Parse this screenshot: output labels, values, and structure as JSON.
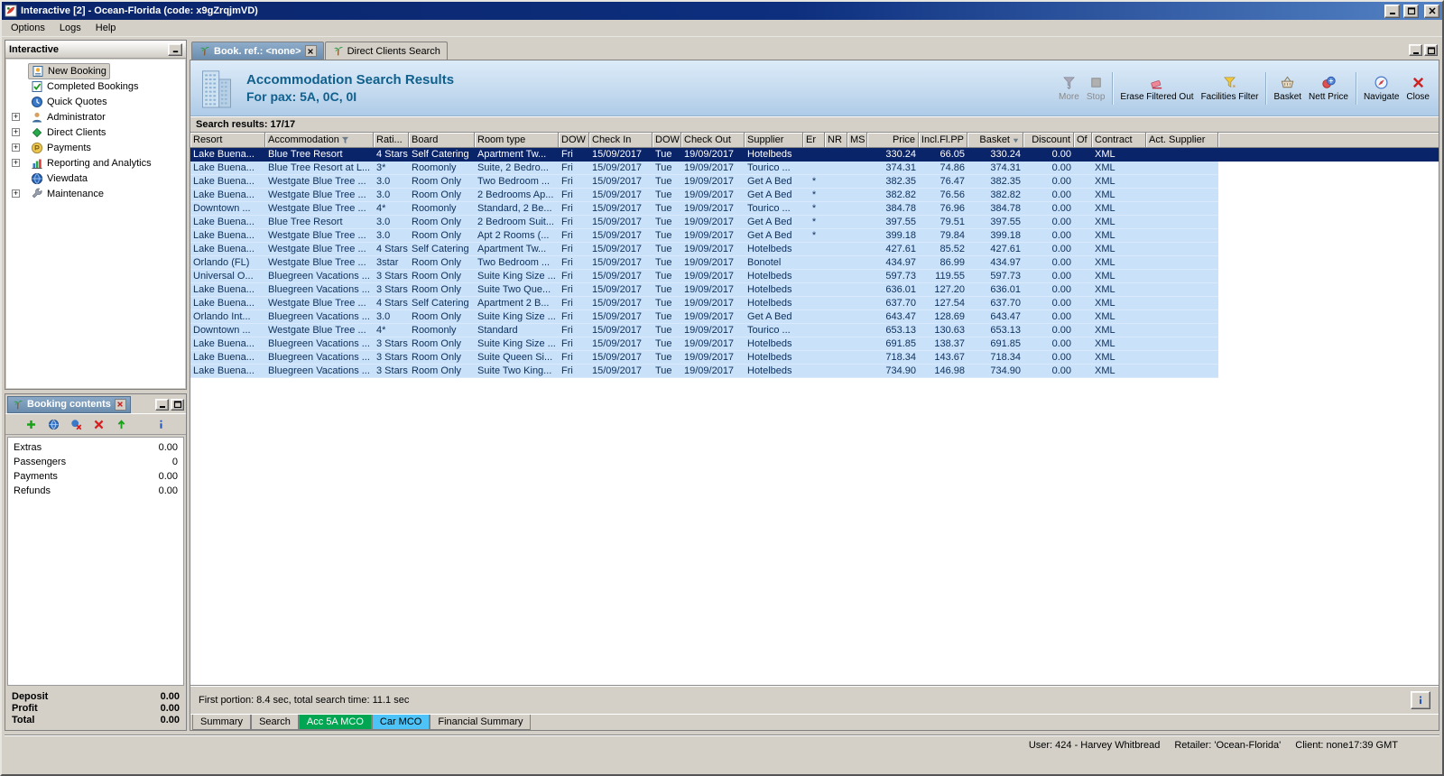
{
  "window": {
    "title": "Interactive [2] - Ocean-Florida (code: x9gZrqjmVD)",
    "menu": [
      "Options",
      "Logs",
      "Help"
    ]
  },
  "sidebar": {
    "title": "Interactive",
    "items": [
      {
        "label": "New Booking",
        "icon": "booking",
        "selected": true
      },
      {
        "label": "Completed Bookings",
        "icon": "completed"
      },
      {
        "label": "Quick Quotes",
        "icon": "quotes"
      },
      {
        "label": "Administrator",
        "icon": "admin",
        "expandable": true
      },
      {
        "label": "Direct Clients",
        "icon": "clients",
        "expandable": true
      },
      {
        "label": "Payments",
        "icon": "payments",
        "expandable": true
      },
      {
        "label": "Reporting and Analytics",
        "icon": "reporting",
        "expandable": true
      },
      {
        "label": "Viewdata",
        "icon": "viewdata"
      },
      {
        "label": "Maintenance",
        "icon": "maintenance",
        "expandable": true
      }
    ]
  },
  "booking_contents": {
    "title": "Booking contents",
    "toolbar_icons": [
      "add",
      "globe",
      "cancel",
      "delete",
      "export",
      "info"
    ],
    "rows": [
      {
        "label": "Extras",
        "value": "0.00"
      },
      {
        "label": "Passengers",
        "value": "0"
      },
      {
        "label": "Payments",
        "value": "0.00"
      },
      {
        "label": "Refunds",
        "value": "0.00"
      }
    ],
    "totals": [
      {
        "label": "Deposit",
        "value": "0.00"
      },
      {
        "label": "Profit",
        "value": "0.00"
      },
      {
        "label": "Total",
        "value": "0.00"
      }
    ]
  },
  "document_tabs": [
    {
      "label": "Book. ref.: <none>",
      "active": true,
      "closable": true
    },
    {
      "label": "Direct Clients Search",
      "active": false
    }
  ],
  "header": {
    "title": "Accommodation Search Results",
    "subtitle": "For pax: 5A, 0C, 0I",
    "toolbar": [
      {
        "label": "More",
        "icon": "more",
        "disabled": true
      },
      {
        "label": "Stop",
        "icon": "stop",
        "disabled": true
      },
      {
        "separator": true
      },
      {
        "label": "Erase Filtered Out",
        "icon": "eraser"
      },
      {
        "label": "Facilities Filter",
        "icon": "funnel"
      },
      {
        "separator": true
      },
      {
        "label": "Basket",
        "icon": "basket"
      },
      {
        "label": "Nett Price",
        "icon": "coins"
      },
      {
        "separator": true
      },
      {
        "label": "Navigate",
        "icon": "navigate"
      },
      {
        "label": "Close",
        "icon": "close"
      }
    ]
  },
  "results": {
    "label": "Search results: 17/17",
    "selected_index": 0,
    "columns": [
      {
        "label": "Resort"
      },
      {
        "label": "Accommodation",
        "filter": true
      },
      {
        "label": "Rati..."
      },
      {
        "label": "Board"
      },
      {
        "label": "Room type"
      },
      {
        "label": "DOW"
      },
      {
        "label": "Check In"
      },
      {
        "label": "DOW"
      },
      {
        "label": "Check Out"
      },
      {
        "label": "Supplier"
      },
      {
        "label": "Er"
      },
      {
        "label": "NR"
      },
      {
        "label": "MS"
      },
      {
        "label": "Price"
      },
      {
        "label": "Incl.Fl.PP"
      },
      {
        "label": "Basket",
        "sort": true
      },
      {
        "label": "Discount"
      },
      {
        "label": "Of"
      },
      {
        "label": "Contract"
      },
      {
        "label": "Act. Supplier"
      }
    ],
    "rows": [
      [
        "Lake Buena...",
        "Blue Tree Resort",
        "4 Stars",
        "Self Catering",
        "Apartment Tw...",
        "Fri",
        "15/09/2017",
        "Tue",
        "19/09/2017",
        "Hotelbeds",
        "",
        "",
        "",
        "330.24",
        "66.05",
        "330.24",
        "0.00",
        "",
        "XML",
        ""
      ],
      [
        "Lake Buena...",
        "Blue Tree Resort at L...",
        "3*",
        "Roomonly",
        "Suite, 2 Bedro...",
        "Fri",
        "15/09/2017",
        "Tue",
        "19/09/2017",
        "Tourico ...",
        "",
        "",
        "",
        "374.31",
        "74.86",
        "374.31",
        "0.00",
        "",
        "XML",
        ""
      ],
      [
        "Lake Buena...",
        "Westgate Blue Tree ...",
        "3.0",
        "Room Only",
        "Two Bedroom ...",
        "Fri",
        "15/09/2017",
        "Tue",
        "19/09/2017",
        "Get A Bed",
        "*",
        "",
        "",
        "382.35",
        "76.47",
        "382.35",
        "0.00",
        "",
        "XML",
        ""
      ],
      [
        "Lake Buena...",
        "Westgate Blue Tree ...",
        "3.0",
        "Room Only",
        "2 Bedrooms Ap...",
        "Fri",
        "15/09/2017",
        "Tue",
        "19/09/2017",
        "Get A Bed",
        "*",
        "",
        "",
        "382.82",
        "76.56",
        "382.82",
        "0.00",
        "",
        "XML",
        ""
      ],
      [
        "Downtown ...",
        "Westgate Blue Tree ...",
        "4*",
        "Roomonly",
        "Standard, 2 Be...",
        "Fri",
        "15/09/2017",
        "Tue",
        "19/09/2017",
        "Tourico ...",
        "*",
        "",
        "",
        "384.78",
        "76.96",
        "384.78",
        "0.00",
        "",
        "XML",
        ""
      ],
      [
        "Lake Buena...",
        "Blue Tree Resort",
        "3.0",
        "Room Only",
        "2 Bedroom Suit...",
        "Fri",
        "15/09/2017",
        "Tue",
        "19/09/2017",
        "Get A Bed",
        "*",
        "",
        "",
        "397.55",
        "79.51",
        "397.55",
        "0.00",
        "",
        "XML",
        ""
      ],
      [
        "Lake Buena...",
        "Westgate Blue Tree ...",
        "3.0",
        "Room Only",
        "Apt 2 Rooms (...",
        "Fri",
        "15/09/2017",
        "Tue",
        "19/09/2017",
        "Get A Bed",
        "*",
        "",
        "",
        "399.18",
        "79.84",
        "399.18",
        "0.00",
        "",
        "XML",
        ""
      ],
      [
        "Lake Buena...",
        "Westgate Blue Tree ...",
        "4 Stars",
        "Self Catering",
        "Apartment Tw...",
        "Fri",
        "15/09/2017",
        "Tue",
        "19/09/2017",
        "Hotelbeds",
        "",
        "",
        "",
        "427.61",
        "85.52",
        "427.61",
        "0.00",
        "",
        "XML",
        ""
      ],
      [
        "Orlando (FL)",
        "Westgate Blue Tree ...",
        "3star",
        "Room Only",
        "Two Bedroom ...",
        "Fri",
        "15/09/2017",
        "Tue",
        "19/09/2017",
        "Bonotel",
        "",
        "",
        "",
        "434.97",
        "86.99",
        "434.97",
        "0.00",
        "",
        "XML",
        ""
      ],
      [
        "Universal O...",
        "Bluegreen Vacations ...",
        "3 Stars",
        "Room Only",
        "Suite King Size ...",
        "Fri",
        "15/09/2017",
        "Tue",
        "19/09/2017",
        "Hotelbeds",
        "",
        "",
        "",
        "597.73",
        "119.55",
        "597.73",
        "0.00",
        "",
        "XML",
        ""
      ],
      [
        "Lake Buena...",
        "Bluegreen Vacations ...",
        "3 Stars",
        "Room Only",
        "Suite Two Que...",
        "Fri",
        "15/09/2017",
        "Tue",
        "19/09/2017",
        "Hotelbeds",
        "",
        "",
        "",
        "636.01",
        "127.20",
        "636.01",
        "0.00",
        "",
        "XML",
        ""
      ],
      [
        "Lake Buena...",
        "Westgate Blue Tree ...",
        "4 Stars",
        "Self Catering",
        "Apartment 2 B...",
        "Fri",
        "15/09/2017",
        "Tue",
        "19/09/2017",
        "Hotelbeds",
        "",
        "",
        "",
        "637.70",
        "127.54",
        "637.70",
        "0.00",
        "",
        "XML",
        ""
      ],
      [
        "Orlando Int...",
        "Bluegreen Vacations ...",
        "3.0",
        "Room Only",
        "Suite King Size ...",
        "Fri",
        "15/09/2017",
        "Tue",
        "19/09/2017",
        "Get A Bed",
        "",
        "",
        "",
        "643.47",
        "128.69",
        "643.47",
        "0.00",
        "",
        "XML",
        ""
      ],
      [
        "Downtown ...",
        "Westgate Blue Tree ...",
        "4*",
        "Roomonly",
        "Standard",
        "Fri",
        "15/09/2017",
        "Tue",
        "19/09/2017",
        "Tourico ...",
        "",
        "",
        "",
        "653.13",
        "130.63",
        "653.13",
        "0.00",
        "",
        "XML",
        ""
      ],
      [
        "Lake Buena...",
        "Bluegreen Vacations ...",
        "3 Stars",
        "Room Only",
        "Suite King Size ...",
        "Fri",
        "15/09/2017",
        "Tue",
        "19/09/2017",
        "Hotelbeds",
        "",
        "",
        "",
        "691.85",
        "138.37",
        "691.85",
        "0.00",
        "",
        "XML",
        ""
      ],
      [
        "Lake Buena...",
        "Bluegreen Vacations ...",
        "3 Stars",
        "Room Only",
        "Suite Queen Si...",
        "Fri",
        "15/09/2017",
        "Tue",
        "19/09/2017",
        "Hotelbeds",
        "",
        "",
        "",
        "718.34",
        "143.67",
        "718.34",
        "0.00",
        "",
        "XML",
        ""
      ],
      [
        "Lake Buena...",
        "Bluegreen Vacations ...",
        "3 Stars",
        "Room Only",
        "Suite Two King...",
        "Fri",
        "15/09/2017",
        "Tue",
        "19/09/2017",
        "Hotelbeds",
        "",
        "",
        "",
        "734.90",
        "146.98",
        "734.90",
        "0.00",
        "",
        "XML",
        ""
      ]
    ]
  },
  "doc_footer": {
    "status": "First portion: 8.4 sec, total search time: 11.1 sec",
    "tabs": [
      {
        "label": "Summary"
      },
      {
        "label": "Search"
      },
      {
        "label": "Acc 5A MCO",
        "bg": "#00a651",
        "fg": "#ffffff"
      },
      {
        "label": "Car MCO",
        "bg": "#4dc3f7",
        "fg": "#000000"
      },
      {
        "label": "Financial Summary"
      }
    ]
  },
  "statusbar": {
    "user": "User: 424 - Harvey Whitbread",
    "retailer": "Retailer: 'Ocean-Florida'",
    "client": "Client: none",
    "time": "17:39 GMT"
  },
  "colors": {
    "selected_row": "#0a246a",
    "row_blue": "#c9e1f9",
    "header_title": "#10608e",
    "acc_tab_green": "#00a651",
    "car_tab_cyan": "#4dc3f7"
  }
}
